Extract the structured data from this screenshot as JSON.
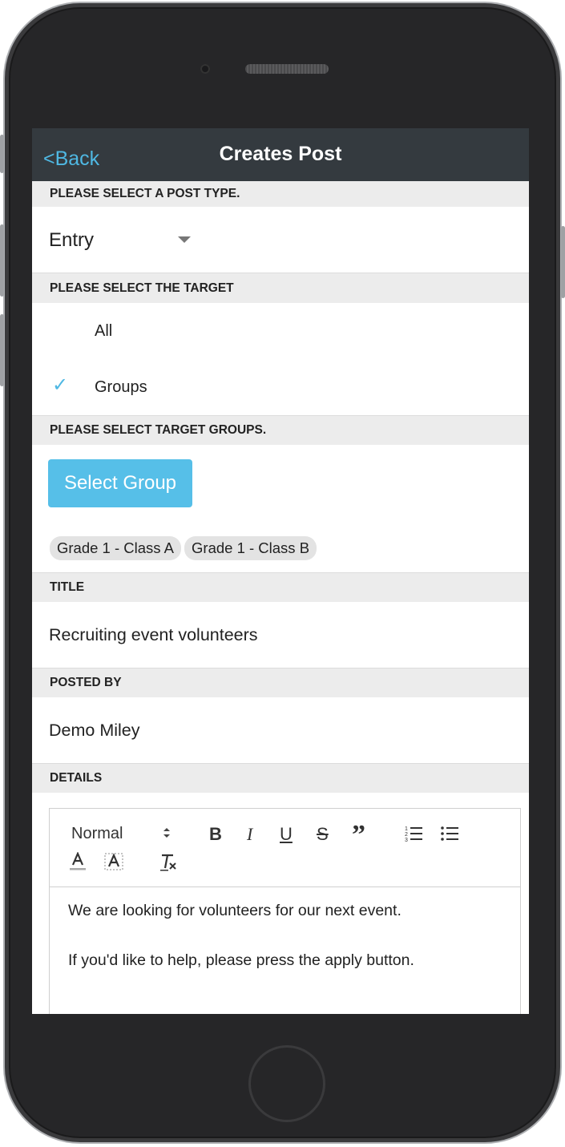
{
  "nav": {
    "back_label": "<Back",
    "title": "Creates Post"
  },
  "post_type": {
    "section_label": "PLEASE SELECT A POST TYPE.",
    "selected": "Entry"
  },
  "target": {
    "section_label": "PLEASE SELECT THE TARGET",
    "options": [
      {
        "label": "All",
        "checked": false
      },
      {
        "label": "Groups",
        "checked": true
      }
    ]
  },
  "groups": {
    "section_label": "PLEASE SELECT TARGET GROUPS.",
    "button_label": "Select Group",
    "chips": [
      "Grade 1 - Class A",
      "Grade 1 - Class B"
    ]
  },
  "title_field": {
    "section_label": "TITLE",
    "value": "Recruiting event volunteers"
  },
  "posted_by": {
    "section_label": "POSTED BY",
    "value": "Demo Miley"
  },
  "details": {
    "section_label": "DETAILS",
    "format_select": "Normal",
    "paragraphs": [
      "We are looking for volunteers for our next event.",
      "If you'd like to help, please press the apply button."
    ]
  },
  "colors": {
    "accent": "#4fb8e3",
    "nav_bg": "#343a3f",
    "section_bg": "#ececec",
    "button_bg": "#56bfe8"
  }
}
